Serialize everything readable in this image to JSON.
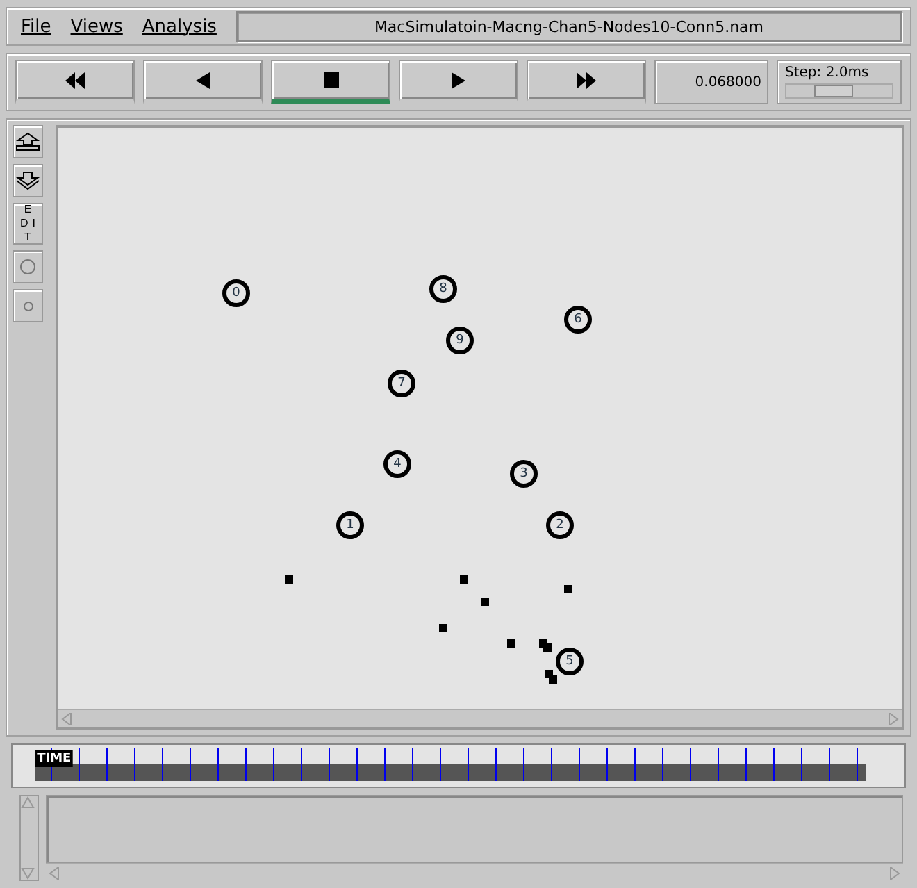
{
  "menu": [
    {
      "label": "File"
    },
    {
      "label": "Views"
    },
    {
      "label": "Analysis"
    }
  ],
  "file_name": "MacSimulatoin-Macng-Chan5-Nodes10-Conn5.nam",
  "playback_buttons": [
    {
      "kind": "rewind",
      "selected": false
    },
    {
      "kind": "back",
      "selected": false
    },
    {
      "kind": "stop",
      "selected": true
    },
    {
      "kind": "play",
      "selected": false
    },
    {
      "kind": "forward",
      "selected": false
    }
  ],
  "time_display": "0.068000",
  "step": {
    "label": "Step: 2.0ms",
    "level": 0.45
  },
  "tools": [
    {
      "kind": "zoom_in"
    },
    {
      "kind": "zoom_out"
    },
    {
      "kind": "edit",
      "label": "EDIT"
    },
    {
      "kind": "large_circle"
    },
    {
      "kind": "small_circle"
    }
  ],
  "nodes": [
    {
      "label": "0"
    },
    {
      "label": "8"
    },
    {
      "label": "6"
    },
    {
      "label": "9"
    },
    {
      "label": "7"
    },
    {
      "label": "4"
    },
    {
      "label": "3"
    },
    {
      "label": "1"
    },
    {
      "label": "2"
    },
    {
      "label": "5"
    }
  ],
  "timeline": {
    "label": "TIME",
    "level": 0.03
  }
}
